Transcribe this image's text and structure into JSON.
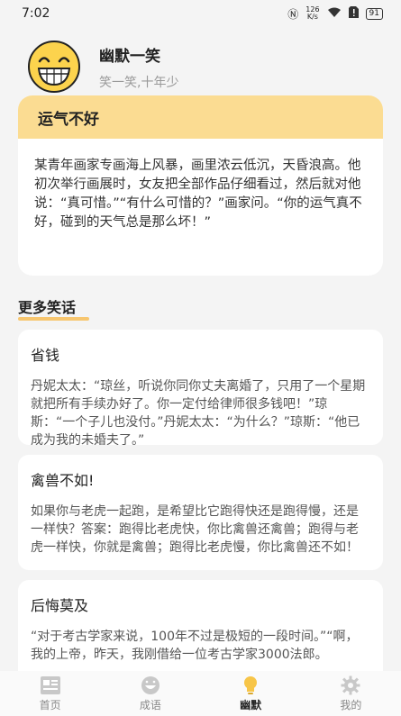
{
  "status_bar": {
    "time": "7:02",
    "net_speed_value": "126",
    "net_speed_unit": "K/s",
    "battery": "91"
  },
  "header": {
    "app_name": "幽默一笑",
    "subtitle": "笑一笑,十年少"
  },
  "featured": {
    "title": "运气不好",
    "body": "某青年画家专画海上风暴，画里浓云低沉，天昏浪高。他初次举行画展时，女友把全部作品仔细看过，然后就对他说：“真可惜。”“有什么可惜的？”画家问。“你的运气真不好，碰到的天气总是那么坏！”"
  },
  "section": {
    "title": "更多笑话"
  },
  "jokes": [
    {
      "title": "省钱",
      "body": "丹妮太太：“琼丝，听说你同你丈夫离婚了，只用了一个星期就把所有手续办好了。你一定付给律师很多钱吧！”琼斯：“一个子儿也没付。”丹妮太太：“为什么？”琼斯：“他已成为我的未婚夫了。”"
    },
    {
      "title": "禽兽不如!",
      "body": "如果你与老虎一起跑，是希望比它跑得快还是跑得慢，还是一样快？答案：跑得比老虎快，你比禽兽还禽兽；跑得与老虎一样快，你就是禽兽；跑得比老虎慢，你比禽兽还不如！"
    },
    {
      "title": "后悔莫及",
      "body": "“对于考古学家来说，100年不过是极短的一段时间。”“啊，我的上帝，昨天，我刚借给一位考古学家3000法郎。"
    }
  ],
  "tabs": [
    {
      "label": "首页",
      "icon": "news-icon",
      "active": false
    },
    {
      "label": "成语",
      "icon": "smile-icon",
      "active": false
    },
    {
      "label": "幽默",
      "icon": "lightbulb-icon",
      "active": true
    },
    {
      "label": "我的",
      "icon": "gear-icon",
      "active": false
    }
  ],
  "colors": {
    "accent": "#f7c66f",
    "featured_header": "#fbdc92",
    "avatar_yellow": "#fcd34d"
  }
}
